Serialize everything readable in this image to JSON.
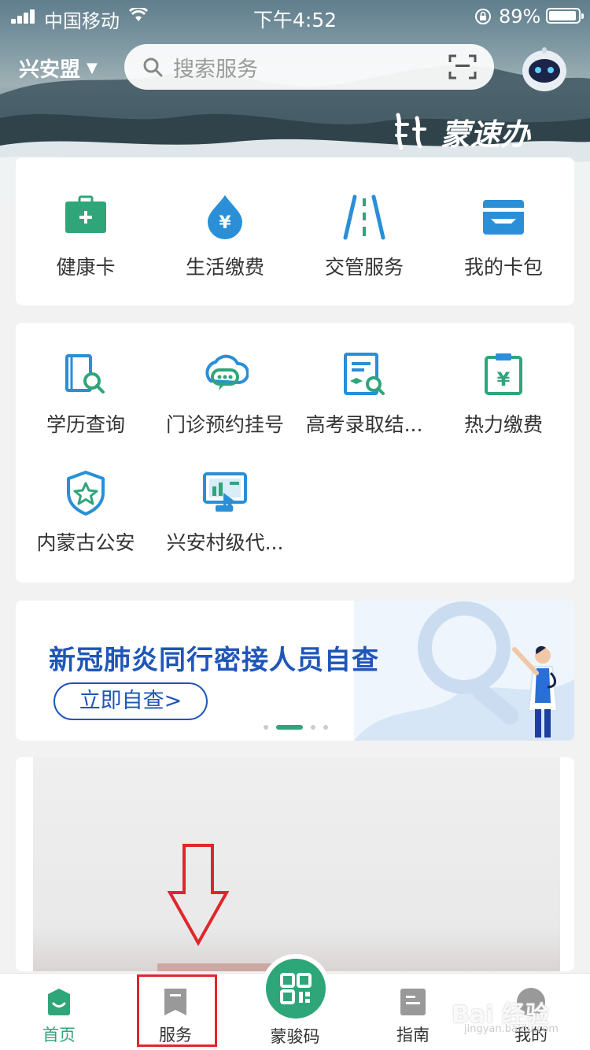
{
  "status_bar": {
    "carrier": "中国移动",
    "time": "下午4:52",
    "battery": "89%"
  },
  "header": {
    "city": "兴安盟",
    "search_placeholder": "搜索服务",
    "brand": "蒙速办"
  },
  "quick_services": [
    {
      "label": "健康卡",
      "icon": "health-card-icon"
    },
    {
      "label": "生活缴费",
      "icon": "utility-payment-icon"
    },
    {
      "label": "交管服务",
      "icon": "traffic-road-icon"
    },
    {
      "label": "我的卡包",
      "icon": "card-wallet-icon"
    }
  ],
  "recommended_services": [
    {
      "label": "学历查询",
      "icon": "education-search-icon"
    },
    {
      "label": "门诊预约挂号",
      "icon": "clinic-appointment-icon"
    },
    {
      "label": "高考录取结...",
      "icon": "exam-result-icon"
    },
    {
      "label": "热力缴费",
      "icon": "heating-payment-icon"
    },
    {
      "label": "内蒙古公安",
      "icon": "police-shield-icon"
    },
    {
      "label": "兴安村级代...",
      "icon": "village-service-icon"
    }
  ],
  "banner": {
    "title": "新冠肺炎同行密接人员自查",
    "cta": "立即自查>"
  },
  "tabs": [
    {
      "label": "首页",
      "icon": "home-icon",
      "active": true
    },
    {
      "label": "服务",
      "icon": "bookmark-icon",
      "active": false
    },
    {
      "label": "蒙骏码",
      "icon": "qr-code-icon",
      "active": false
    },
    {
      "label": "指南",
      "icon": "guide-icon",
      "active": false
    },
    {
      "label": "我的",
      "icon": "profile-icon",
      "active": false
    }
  ],
  "watermark": {
    "text": "Bai 经验",
    "url": "jingyan.baidu.com"
  },
  "colors": {
    "primary": "#2fa57a",
    "blue": "#1f56b8",
    "icon_blue": "#2a8fd6",
    "highlight": "#e0262a"
  }
}
